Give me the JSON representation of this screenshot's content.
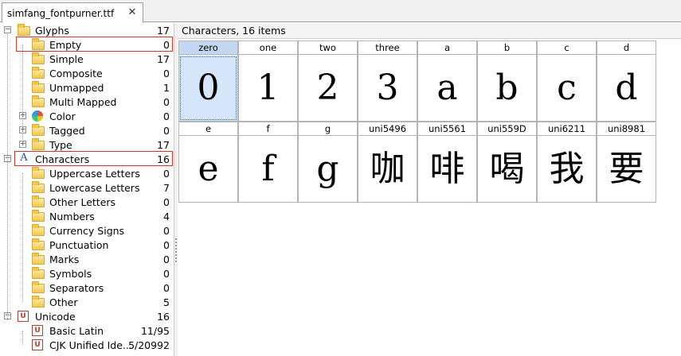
{
  "tab": {
    "label": "simfang_fontpurner.ttf",
    "close_glyph": "✕"
  },
  "tree": [
    {
      "id": "glyphs",
      "label": "Glyphs",
      "count": "17",
      "level": 0,
      "expander": "minus",
      "icon": "folder-icon"
    },
    {
      "id": "empty",
      "label": "Empty",
      "count": "0",
      "level": 1,
      "icon": "folder-icon"
    },
    {
      "id": "simple",
      "label": "Simple",
      "count": "17",
      "level": 1,
      "icon": "folder-icon"
    },
    {
      "id": "composite",
      "label": "Composite",
      "count": "0",
      "level": 1,
      "icon": "folder-icon"
    },
    {
      "id": "unmapped",
      "label": "Unmapped",
      "count": "1",
      "level": 1,
      "icon": "folder-icon"
    },
    {
      "id": "multi-mapped",
      "label": "Multi Mapped",
      "count": "0",
      "level": 1,
      "icon": "folder-icon"
    },
    {
      "id": "color",
      "label": "Color",
      "count": "0",
      "level": 1,
      "expander": "plus",
      "icon": "color-wheel-icon"
    },
    {
      "id": "tagged",
      "label": "Tagged",
      "count": "0",
      "level": 1,
      "expander": "plus",
      "icon": "folder-icon"
    },
    {
      "id": "type",
      "label": "Type",
      "count": "17",
      "level": 1,
      "expander": "plus",
      "icon": "folder-icon"
    },
    {
      "id": "characters",
      "label": "Characters",
      "count": "16",
      "level": 0,
      "expander": "minus",
      "icon": "character-a-icon"
    },
    {
      "id": "uppercase",
      "label": "Uppercase Letters",
      "count": "0",
      "level": 1,
      "icon": "folder-icon"
    },
    {
      "id": "lowercase",
      "label": "Lowercase Letters",
      "count": "7",
      "level": 1,
      "icon": "folder-icon"
    },
    {
      "id": "other-letters",
      "label": "Other Letters",
      "count": "0",
      "level": 1,
      "icon": "folder-icon"
    },
    {
      "id": "numbers",
      "label": "Numbers",
      "count": "4",
      "level": 1,
      "icon": "folder-icon"
    },
    {
      "id": "currency",
      "label": "Currency Signs",
      "count": "0",
      "level": 1,
      "icon": "folder-icon"
    },
    {
      "id": "punctuation",
      "label": "Punctuation",
      "count": "0",
      "level": 1,
      "icon": "folder-icon"
    },
    {
      "id": "marks",
      "label": "Marks",
      "count": "0",
      "level": 1,
      "icon": "folder-icon"
    },
    {
      "id": "symbols",
      "label": "Symbols",
      "count": "0",
      "level": 1,
      "icon": "folder-icon"
    },
    {
      "id": "separators",
      "label": "Separators",
      "count": "0",
      "level": 1,
      "icon": "folder-icon"
    },
    {
      "id": "other",
      "label": "Other",
      "count": "5",
      "level": 1,
      "icon": "folder-icon"
    },
    {
      "id": "unicode",
      "label": "Unicode",
      "count": "16",
      "level": 0,
      "expander": "minus",
      "icon": "unicode-icon"
    },
    {
      "id": "basic-latin",
      "label": "Basic Latin",
      "count": "11/95",
      "level": 1,
      "icon": "unicode-icon"
    },
    {
      "id": "cjk",
      "label": "CJK Unified Ide...",
      "count": "5/20992",
      "level": 1,
      "icon": "unicode-icon"
    }
  ],
  "unicode_icon_text": "U",
  "characters_icon_text": "A",
  "expander_minus": "−",
  "expander_plus": "+",
  "grid": {
    "header": "Characters, 16 items",
    "selected": "zero",
    "cells": [
      {
        "name": "zero",
        "glyph": "0"
      },
      {
        "name": "one",
        "glyph": "1"
      },
      {
        "name": "two",
        "glyph": "2"
      },
      {
        "name": "three",
        "glyph": "3"
      },
      {
        "name": "a",
        "glyph": "a"
      },
      {
        "name": "b",
        "glyph": "b"
      },
      {
        "name": "c",
        "glyph": "c"
      },
      {
        "name": "d",
        "glyph": "d"
      },
      {
        "name": "e",
        "glyph": "e"
      },
      {
        "name": "f",
        "glyph": "f"
      },
      {
        "name": "g",
        "glyph": "g"
      },
      {
        "name": "uni5496",
        "glyph": "咖"
      },
      {
        "name": "uni5561",
        "glyph": "啡"
      },
      {
        "name": "uni559D",
        "glyph": "喝"
      },
      {
        "name": "uni6211",
        "glyph": "我"
      },
      {
        "name": "uni8981",
        "glyph": "要"
      }
    ]
  },
  "colors": {
    "selection": "#d6e6fa",
    "highlight_border": "#e0302a",
    "unicode_red": "#c0392b"
  }
}
